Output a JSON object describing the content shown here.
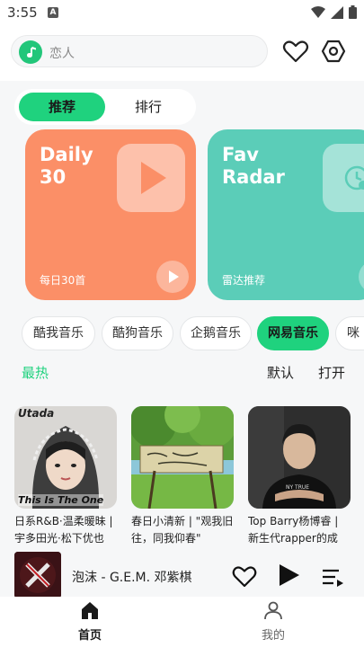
{
  "status": {
    "time": "3:55",
    "notification_letter": "A"
  },
  "search": {
    "placeholder": "恋人"
  },
  "tabs": {
    "recommend": "推荐",
    "ranking": "排行"
  },
  "cards": [
    {
      "title": "Daily\n30",
      "subtitle": "每日30首",
      "color": "#fb8f67"
    },
    {
      "title": "Fav\nRadar",
      "subtitle": "雷达推荐",
      "color": "#5bcdb8"
    }
  ],
  "platforms": [
    "酷我音乐",
    "酷狗音乐",
    "企鹅音乐",
    "网易音乐",
    "咪"
  ],
  "active_platform": "网易音乐",
  "filters": {
    "hot": "最热",
    "default": "默认",
    "open": "打开"
  },
  "playlists": [
    {
      "title": "日系R&B·温柔暖昧 | 宇多田光·松下优也",
      "cover_text_top": "Utada",
      "cover_text_bottom": "This Is The One"
    },
    {
      "title": "春日小清新 | \"观我旧往，同我仰春\"",
      "cover_text_top": "",
      "cover_text_bottom": ""
    },
    {
      "title": "Top Barry杨博睿 | 新生代rapper的成长...",
      "cover_text_top": "",
      "cover_text_bottom": ""
    }
  ],
  "player": {
    "now_playing": "泡沫 - G.E.M. 邓紫棋"
  },
  "nav": {
    "home": "首页",
    "mine": "我的"
  },
  "colors": {
    "accent": "#1fd27e",
    "daily": "#fb8f67",
    "radar": "#5bcdb8"
  }
}
